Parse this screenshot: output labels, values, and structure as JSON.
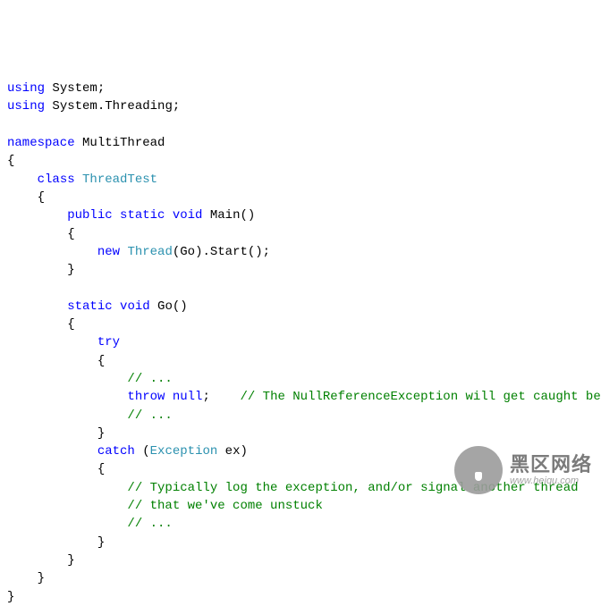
{
  "code": {
    "l1": {
      "kw1": "using",
      "t1": " System;"
    },
    "l2": {
      "kw1": "using",
      "t1": " System.Threading;"
    },
    "l4": {
      "kw1": "namespace",
      "t1": " MultiThread"
    },
    "l5": "{",
    "l6": {
      "indent": "    ",
      "kw1": "class",
      "type1": " ThreadTest"
    },
    "l7": "    {",
    "l8": {
      "indent": "        ",
      "kw1": "public",
      "kw2": " static",
      "kw3": " void",
      "t1": " Main()"
    },
    "l9": "        {",
    "l10": {
      "indent": "            ",
      "kw1": "new",
      "type1": " Thread",
      "t1": "(Go).Start();"
    },
    "l11": "        }",
    "l13": {
      "indent": "        ",
      "kw1": "static",
      "kw2": " void",
      "t1": " Go()"
    },
    "l14": "        {",
    "l15": {
      "indent": "            ",
      "kw1": "try"
    },
    "l16": "            {",
    "l17": {
      "indent": "                ",
      "c1": "// ..."
    },
    "l18": {
      "indent": "                ",
      "kw1": "throw",
      "kw2": " null",
      "t1": ";    ",
      "c1": "// The NullReferenceException will get caught below"
    },
    "l19": {
      "indent": "                ",
      "c1": "// ..."
    },
    "l20": "            }",
    "l21": {
      "indent": "            ",
      "kw1": "catch",
      "t1": " (",
      "type1": "Exception",
      "t2": " ex)"
    },
    "l22": "            {",
    "l23": {
      "indent": "                ",
      "c1": "// Typically log the exception, and/or signal another thread"
    },
    "l24": {
      "indent": "                ",
      "c1": "// that we've come unstuck"
    },
    "l25": {
      "indent": "                ",
      "c1": "// ..."
    },
    "l26": "            }",
    "l27": "        }",
    "l28": "    }",
    "l29": "}"
  },
  "watermark": {
    "cn": "黑区网络",
    "url": "www.heiqu.com"
  }
}
